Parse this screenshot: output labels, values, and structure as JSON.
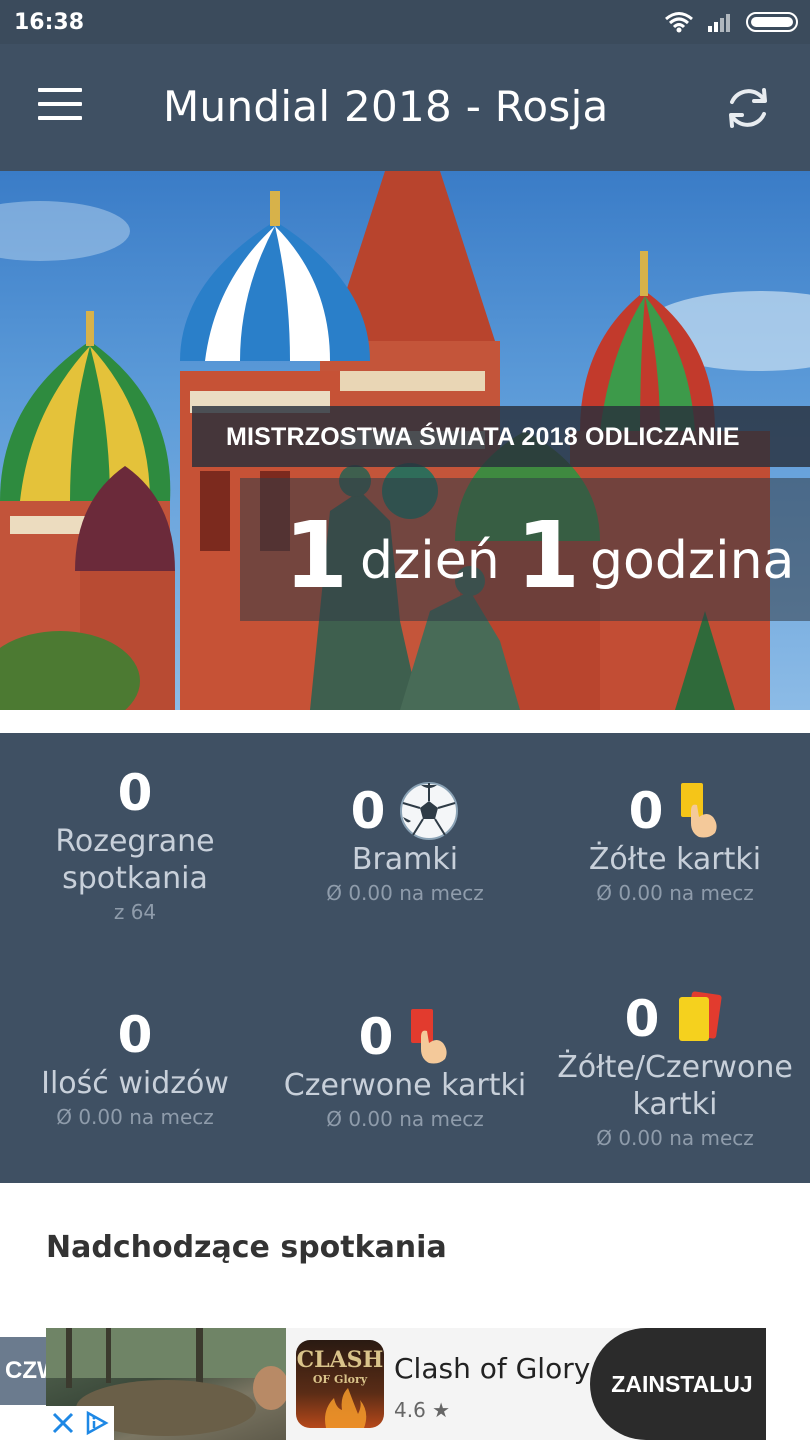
{
  "status_bar": {
    "time": "16:38",
    "icons": [
      "wifi-icon",
      "signal-icon",
      "battery-icon"
    ]
  },
  "toolbar": {
    "title": "Mundial 2018 - Rosja",
    "menu_icon": "hamburger-menu-icon",
    "refresh_icon": "refresh-icon",
    "background": "#3f5063"
  },
  "hero": {
    "label": "MISTRZOSTWA ŚWIATA 2018 ODLICZANIE",
    "days_value": "1",
    "days_unit": "dzień",
    "hours_value": "1",
    "hours_unit": "godzina"
  },
  "stats": [
    {
      "value": "0",
      "label_line1": "Rozegrane",
      "label_line2": "spotkania",
      "sub": "z 64",
      "icon": ""
    },
    {
      "value": "0",
      "label_line1": "Bramki",
      "label_line2": "",
      "sub": "Ø 0.00 na mecz",
      "icon": "soccer-ball-icon"
    },
    {
      "value": "0",
      "label_line1": "Żółte kartki",
      "label_line2": "",
      "sub": "Ø 0.00 na mecz",
      "icon": "yellow-card-icon"
    },
    {
      "value": "0",
      "label_line1": "Ilość widzów",
      "label_line2": "",
      "sub": "Ø 0.00 na mecz",
      "icon": ""
    },
    {
      "value": "0",
      "label_line1": "Czerwone kartki",
      "label_line2": "",
      "sub": "Ø 0.00 na mecz",
      "icon": "red-card-icon"
    },
    {
      "value": "0",
      "label_line1": "Żółte/Czerwone",
      "label_line2": "kartki",
      "sub": "Ø 0.00 na mecz",
      "icon": "yellow-red-card-icon"
    }
  ],
  "upcoming": {
    "title": "Nadchodzące spotkania"
  },
  "ad": {
    "side_tab": "CZW",
    "app_name": "Clash of Glory",
    "rating": "4.6",
    "logo_line1": "CLASH",
    "logo_line2": "OF Glory",
    "cta": "ZAINSTALUJ"
  }
}
